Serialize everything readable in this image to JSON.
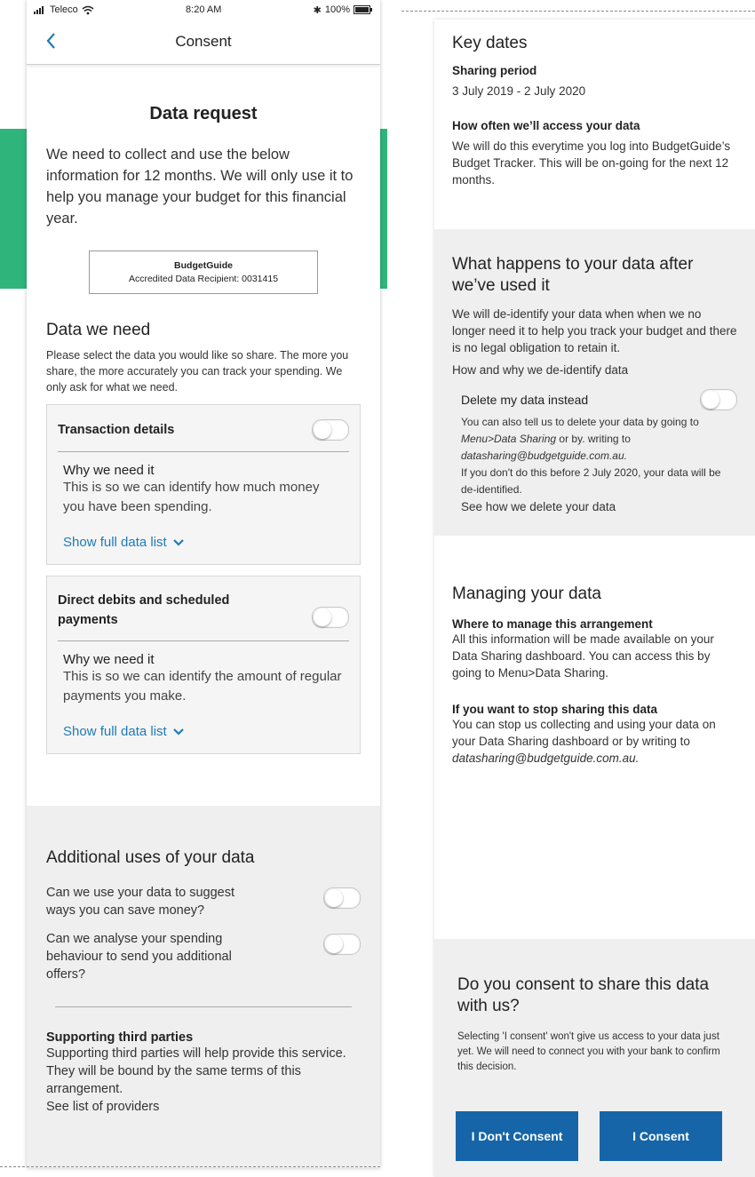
{
  "status_bar": {
    "carrier": "Teleco",
    "time": "8:20 AM",
    "battery": "100%"
  },
  "nav": {
    "title": "Consent"
  },
  "data_request": {
    "title": "Data request",
    "intro": "We need to collect and use the below information for 12 months. We will only use it to help you manage your budget for this financial year.",
    "recipient_name": "BudgetGuide",
    "recipient_id": "Accredited Data Recipient: 0031415"
  },
  "data_we_need": {
    "heading": "Data we need",
    "description": "Please select the data you would like so share. The more you share, the more accurately you can track your spending. We only ask for what we need.",
    "cards": [
      {
        "title": "Transaction details",
        "why_title": "Why we need it",
        "why_text": "This is so we can identify how much money you have been spending.",
        "link": "Show full data list"
      },
      {
        "title": "Direct debits and scheduled payments",
        "why_title": "Why we need it",
        "why_text": "This is so we can identify the amount of regular payments you make.",
        "link": "Show full data list"
      }
    ]
  },
  "additional": {
    "heading": "Additional uses of your data",
    "q1": "Can we use your data to suggest ways you can save money?",
    "q2": "Can we analyse your spending behaviour to send you additional offers?",
    "third_title": "Supporting third parties",
    "third_text": "Supporting third parties will help provide this service. They will be bound by the same terms of this arrangement.",
    "third_link": "See list of providers"
  },
  "key_dates": {
    "heading": "Key dates",
    "period_label": "Sharing period",
    "period_value": "3 July 2019 - 2 July 2020",
    "access_label": "How often we’ll access your data",
    "access_text": "We will do this everytime you log into BudgetGuide’s Budget Tracker. This will be on-going for the next 12 months."
  },
  "after_use": {
    "heading": "What happens to your data after we’ve used it",
    "text": "We will de-identify your data when when we no longer need it to help you track your budget and there is no legal obligation to retain it.",
    "link": "How and why we de-identify data",
    "delete_label": "Delete my data instead",
    "delete_text_1": "You can also tell us to delete your data by going to",
    "delete_menu": "Menu>Data Sharing",
    "delete_text_2": "or by. writing to",
    "delete_email": "datasharing@budgetguide.com.au.",
    "delete_text_3": "If you don't do this before 2 July 2020, your data will be de-identified.",
    "delete_link": "See how we delete your data"
  },
  "managing": {
    "heading": "Managing your data",
    "where_label": "Where to manage this arrangement",
    "where_text": "All this information will be made available on your Data Sharing dashboard. You can access this by going to Menu>Data Sharing.",
    "stop_label": "If you want to stop sharing this data",
    "stop_text": "You can stop us collecting and using your data on your Data Sharing dashboard or by writing to",
    "stop_email": "datasharing@budgetguide.com.au."
  },
  "consent": {
    "heading": "Do you consent to share this data with us?",
    "text": "Selecting 'I consent' won't give us access to your data just yet. We will need to connect you with your bank to confirm this decision.",
    "decline_label": "I Don't Consent",
    "accept_label": "I Consent",
    "button_color": "#1565a8"
  }
}
